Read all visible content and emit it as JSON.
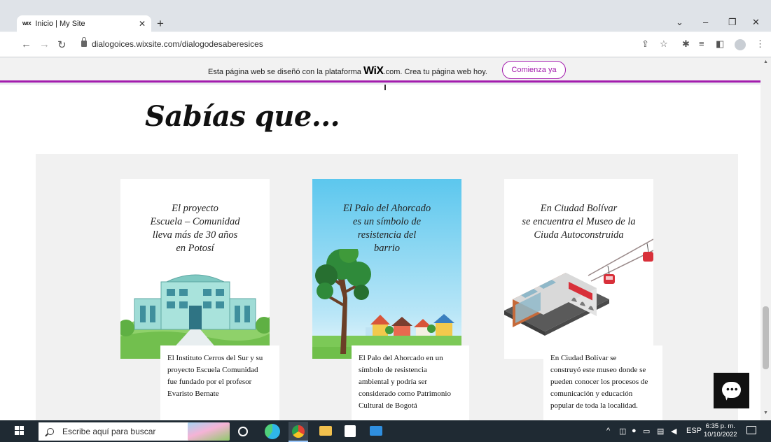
{
  "browser": {
    "tab_favicon": "WIX",
    "tab_title": "Inicio | My Site",
    "tab_close": "✕",
    "new_tab": "+",
    "url": "dialogoices.wixsite.com/dialogodesaberesices",
    "window_controls": {
      "dropdown": "⌄",
      "minimize": "–",
      "restore": "❐",
      "close": "✕"
    },
    "nav": {
      "back": "←",
      "forward": "→",
      "reload": "↻"
    }
  },
  "wix_banner": {
    "text_before": "Esta página web se diseñó con la plataforma ",
    "logo": "WiX",
    "text_after": ".com. Crea tu página web hoy.",
    "cta": "Comienza ya"
  },
  "page": {
    "heading": "Sabías que...",
    "cards": [
      {
        "title_lines": [
          "El proyecto",
          "Escuela – Comunidad",
          "lleva más de 30 años",
          "en Potosí"
        ],
        "note_lines": [
          "El Instituto Cerros del Sur y su",
          "proyecto Escuela Comunidad",
          "fue fundado por el profesor",
          "Evaristo Bernate"
        ]
      },
      {
        "title_lines": [
          "El Palo del Ahorcado",
          "es un símbolo de",
          "resistencia del",
          "barrio"
        ],
        "note_lines": [
          "El Palo del Ahorcado en un",
          "símbolo de resistencia",
          "ambiental y podría ser",
          "considerado como Patrimonio",
          "Cultural de Bogotá"
        ]
      },
      {
        "title_lines": [
          "En Ciudad Bolívar",
          "se encuentra el Museo de la",
          "Ciuda Autoconstruida"
        ],
        "note_lines": [
          "En Ciudad Bolívar se",
          "construyó este museo donde se",
          "pueden conocer los procesos de",
          "comunicación y educación",
          "popular de toda la localidad."
        ]
      }
    ]
  },
  "chat": {
    "icon": "chat-bubble-icon"
  },
  "taskbar": {
    "search_placeholder": "Escribe aquí para buscar",
    "language": "ESP",
    "time": "6:35 p. m.",
    "date": "10/10/2022"
  },
  "colors": {
    "wix_accent": "#a31cad",
    "band": "#f1f1f1",
    "taskbar": "#1f2a33"
  }
}
